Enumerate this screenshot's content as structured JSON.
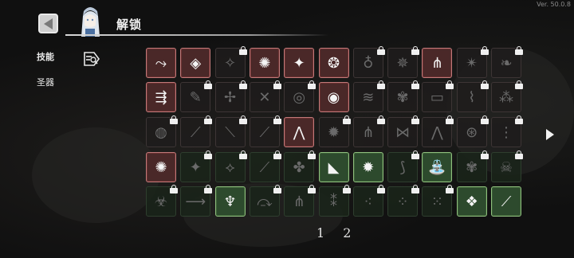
{
  "version": "Ver. 50.0.8",
  "header": {
    "title": "解锁",
    "back_icon": "back-arrow-icon",
    "portrait_icon": "hero-portrait-icon"
  },
  "nav": {
    "items": [
      {
        "label": "技能",
        "active": true
      },
      {
        "label": "圣器",
        "active": false
      }
    ],
    "filter_icon": "filter-sort-icon"
  },
  "grid": {
    "rows": [
      [
        "red",
        "red",
        "lock",
        "red",
        "red",
        "red",
        "lock",
        "lock",
        "red",
        "lock",
        "lock"
      ],
      [
        "red",
        "lock",
        "lock",
        "lock",
        "lock",
        "red",
        "lock",
        "lock",
        "lock",
        "lock",
        "lock"
      ],
      [
        "lock",
        "lock",
        "lock",
        "lock",
        "red",
        "lock",
        "lock",
        "lock",
        "lock",
        "lock",
        "lock"
      ],
      [
        "red",
        "lock",
        "lock",
        "lock",
        "lock",
        "green",
        "green",
        "lock",
        "green",
        "lock",
        "lock"
      ],
      [
        "lockg",
        "lock",
        "green",
        "lock",
        "lock",
        "lock",
        "lock",
        "lock",
        "lock",
        "green",
        "green"
      ]
    ],
    "icons": [
      [
        "⤳",
        "◈",
        "✧",
        "✺",
        "✦",
        "❂",
        "♁",
        "✵",
        "⋔",
        "✴",
        "❧"
      ],
      [
        "⇶",
        "✎",
        "✢",
        "✕",
        "◎",
        "◉",
        "≋",
        "✾",
        "▭",
        "⌇",
        "⁂"
      ],
      [
        "◍",
        "⟋",
        "⟍",
        "⟋",
        "⋀",
        "✹",
        "⋔",
        "⋈",
        "⋀",
        "⊛",
        "⋮"
      ],
      [
        "✺",
        "✦",
        "⟡",
        "⟋",
        "✤",
        "◣",
        "✹",
        "⟆",
        "⛲",
        "✾",
        "☠"
      ],
      [
        "☣",
        "⟶",
        "♆",
        "⤼",
        "⋔",
        "⁑",
        "⁖",
        "⁘",
        "⁙",
        "❖",
        "⟋"
      ]
    ]
  },
  "next_page_icon": "next-page-arrow-icon",
  "pager": {
    "pages": [
      "1",
      "2"
    ]
  }
}
